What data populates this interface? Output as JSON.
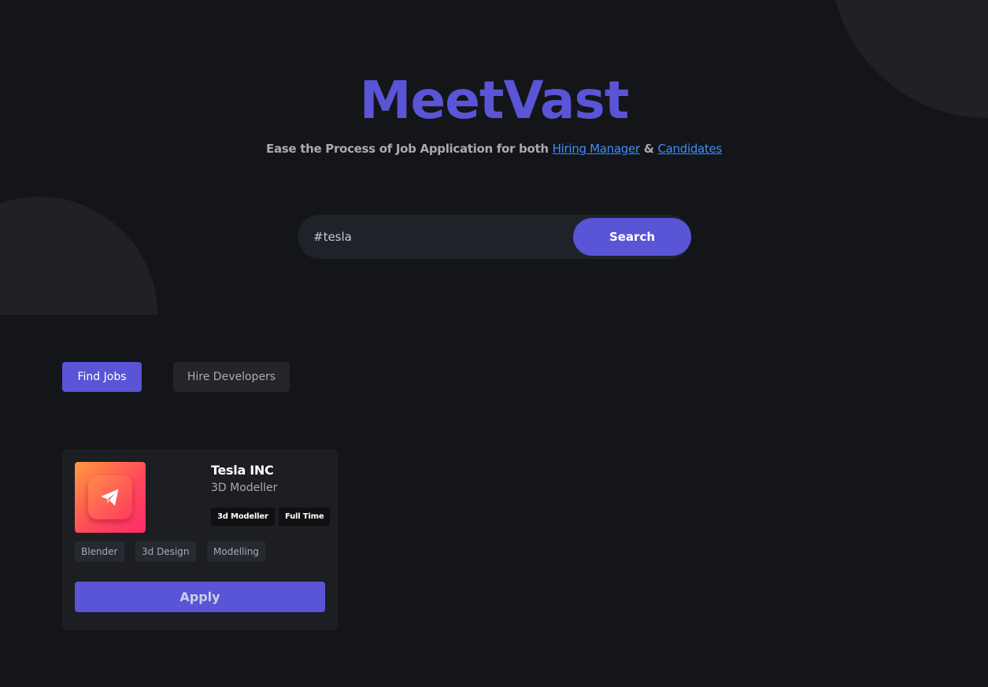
{
  "header": {
    "brand": "MeetVast",
    "tagline_prefix": "Ease the Process of Job Application for both ",
    "tagline_link_hiring": "Hiring Manager",
    "tagline_between": " & ",
    "tagline_link_candidates": "Candidates"
  },
  "search": {
    "value": "#tesla",
    "button_label": "Search"
  },
  "tabs": [
    {
      "label": "Find Jobs",
      "active": true
    },
    {
      "label": "Hire Developers",
      "active": false
    }
  ],
  "jobs": [
    {
      "company": "Tesla INC",
      "title": "3D Modeller",
      "badges": [
        "3d Modeller",
        "Full Time"
      ],
      "skills": [
        "Blender",
        "3d Design",
        "Modelling"
      ],
      "apply_label": "Apply",
      "logo_icon": "telegram-paper-plane-icon"
    }
  ],
  "colors": {
    "background": "#141518",
    "accent": "#5a54d6",
    "link": "#3d8cff",
    "card": "#1c1e22",
    "muted_text": "#a9aab0"
  }
}
